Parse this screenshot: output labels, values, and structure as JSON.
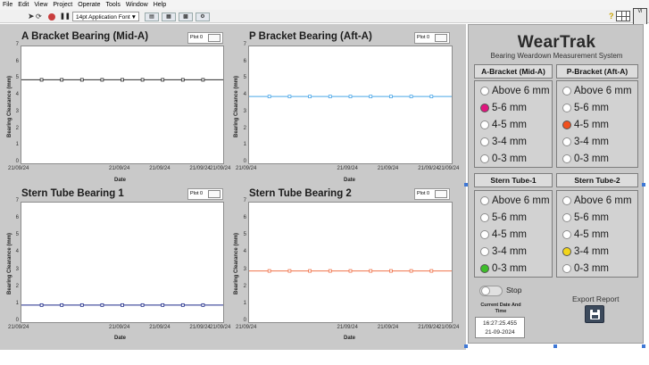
{
  "menu": [
    "File",
    "Edit",
    "View",
    "Project",
    "Operate",
    "Tools",
    "Window",
    "Help"
  ],
  "toolbar": {
    "font_label": "14pt Application Font",
    "help_glyph": "?"
  },
  "charts": [
    {
      "title": "A Bracket Bearing (Mid-A)",
      "legend": "Plot 0",
      "ylabel": "Bearing Clearance (mm)",
      "xlabel": "Date",
      "yticks": [
        "0",
        "1",
        "2",
        "3",
        "4",
        "5",
        "6",
        "7"
      ],
      "xticks": [
        "21/09/24",
        "21/09/24",
        "21/09/24",
        "21/09/24",
        "21/09/24"
      ],
      "color": "#2b2b2b",
      "value": 5
    },
    {
      "title": "P Bracket Bearing (Aft-A)",
      "legend": "Plot 0",
      "ylabel": "Bearing Clearance (mm)",
      "xlabel": "Date",
      "yticks": [
        "0",
        "1",
        "2",
        "3",
        "4",
        "5",
        "6",
        "7"
      ],
      "xticks": [
        "21/09/24",
        "21/09/24",
        "21/09/24",
        "21/09/24",
        "21/09/24"
      ],
      "color": "#4aa6e8",
      "value": 4
    },
    {
      "title": "Stern Tube Bearing 1",
      "legend": "Plot 0",
      "ylabel": "Bearing Clearance (mm)",
      "xlabel": "Date",
      "yticks": [
        "0",
        "1",
        "2",
        "3",
        "4",
        "5",
        "6",
        "7"
      ],
      "xticks": [
        "21/09/24",
        "21/09/24",
        "21/09/24",
        "21/09/24",
        "21/09/24"
      ],
      "color": "#1d2a8a",
      "value": 1
    },
    {
      "title": "Stern Tube Bearing 2",
      "legend": "Plot 0",
      "ylabel": "Bearing Clearance (mm)",
      "xlabel": "Date",
      "yticks": [
        "0",
        "1",
        "2",
        "3",
        "4",
        "5",
        "6",
        "7"
      ],
      "xticks": [
        "21/09/24",
        "21/09/24",
        "21/09/24",
        "21/09/24",
        "21/09/24"
      ],
      "color": "#f0724a",
      "value": 3
    }
  ],
  "chart_data": [
    {
      "type": "line",
      "title": "A Bracket Bearing (Mid-A)",
      "xlabel": "Date",
      "ylabel": "Bearing Clearance (mm)",
      "ylim": [
        0,
        7
      ],
      "series": [
        {
          "name": "Plot 0",
          "values": [
            5,
            5,
            5,
            5,
            5,
            5,
            5,
            5,
            5,
            5,
            5
          ]
        }
      ]
    },
    {
      "type": "line",
      "title": "P Bracket Bearing (Aft-A)",
      "xlabel": "Date",
      "ylabel": "Bearing Clearance (mm)",
      "ylim": [
        0,
        7
      ],
      "series": [
        {
          "name": "Plot 0",
          "values": [
            4,
            4,
            4,
            4,
            4,
            4,
            4,
            4,
            4,
            4,
            4
          ]
        }
      ]
    },
    {
      "type": "line",
      "title": "Stern Tube Bearing 1",
      "xlabel": "Date",
      "ylabel": "Bearing Clearance (mm)",
      "ylim": [
        0,
        7
      ],
      "series": [
        {
          "name": "Plot 0",
          "values": [
            1,
            1,
            1,
            1,
            1,
            1,
            1,
            1,
            1,
            1,
            1
          ]
        }
      ]
    },
    {
      "type": "line",
      "title": "Stern Tube Bearing 2",
      "xlabel": "Date",
      "ylabel": "Bearing Clearance (mm)",
      "ylim": [
        0,
        7
      ],
      "series": [
        {
          "name": "Plot 0",
          "values": [
            3,
            3,
            3,
            3,
            3,
            3,
            3,
            3,
            3,
            3,
            3
          ]
        }
      ]
    }
  ],
  "weartrak": {
    "title": "WearTrak",
    "subtitle": "Bearing Weardown Measurement System",
    "groups": [
      {
        "header": "A-Bracket (Mid-A)",
        "active_color": "#e0157e",
        "active_index": 1,
        "options": [
          "Above 6 mm",
          "5-6 mm",
          "4-5 mm",
          "3-4 mm",
          "0-3 mm"
        ]
      },
      {
        "header": "P-Bracket (Aft-A)",
        "active_color": "#f0501e",
        "active_index": 2,
        "options": [
          "Above 6 mm",
          "5-6 mm",
          "4-5 mm",
          "3-4 mm",
          "0-3 mm"
        ]
      },
      {
        "header": "Stern Tube-1",
        "active_color": "#3dbd2a",
        "active_index": 4,
        "options": [
          "Above 6 mm",
          "5-6 mm",
          "4-5 mm",
          "3-4 mm",
          "0-3 mm"
        ]
      },
      {
        "header": "Stern Tube-2",
        "active_color": "#f2d51a",
        "active_index": 3,
        "options": [
          "Above 6 mm",
          "5-6 mm",
          "4-5 mm",
          "3-4 mm",
          "0-3 mm"
        ]
      }
    ],
    "stop_label": "Stop",
    "datetime_label": "Current Date And Time",
    "time": "16:27:25.455",
    "date": "21-09-2024",
    "export_label": "Export Report"
  }
}
